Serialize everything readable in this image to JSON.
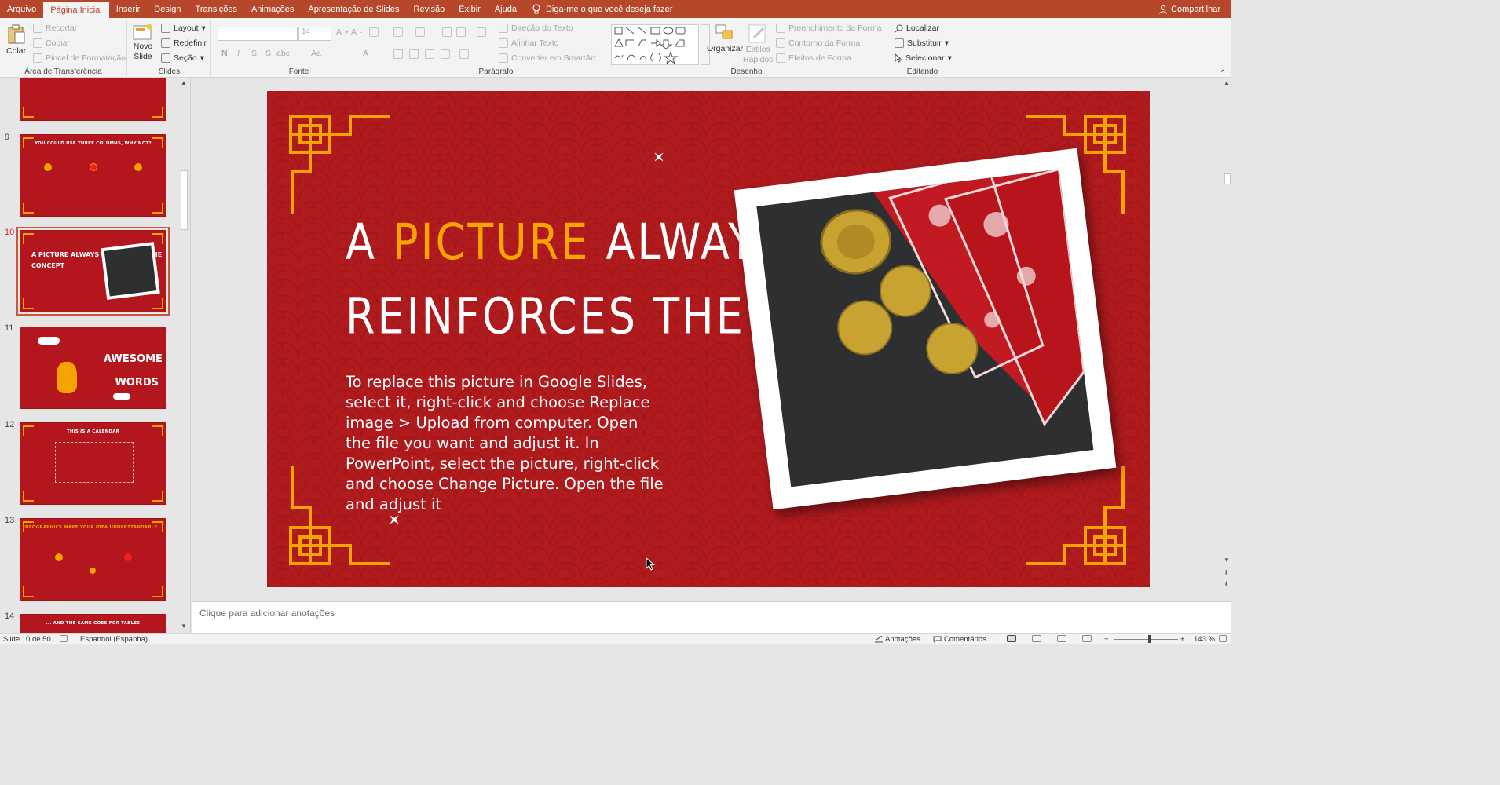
{
  "tabs": [
    "Arquivo",
    "Página Inicial",
    "Inserir",
    "Design",
    "Transições",
    "Animações",
    "Apresentação de Slides",
    "Revisão",
    "Exibir",
    "Ajuda"
  ],
  "active_tab": "Página Inicial",
  "tell_me": "Diga-me o que você deseja fazer",
  "share": "Compartilhar",
  "ribbon": {
    "clipboard": {
      "paste": "Colar",
      "cut": "Recortar",
      "copy": "Copiar",
      "format_painter": "Pincel de Formatação",
      "label": "Área de Transferência"
    },
    "slides": {
      "new_slide_1": "Novo",
      "new_slide_2": "Slide",
      "layout": "Layout",
      "reset": "Redefinir",
      "section": "Seção",
      "label": "Slides"
    },
    "font": {
      "size": "14",
      "label": "Fonte",
      "bold": "N",
      "italic": "I",
      "underline": "S",
      "shadow": "S",
      "strike": "abc",
      "case": "Aa",
      "color": "A"
    },
    "paragraph": {
      "text_direction": "Direção do Texto",
      "align_text": "Alinhar Texto",
      "smartart": "Converter em SmartArt",
      "label": "Parágrafo"
    },
    "drawing": {
      "arrange": "Organizar",
      "quick_styles_1": "Estilos",
      "quick_styles_2": "Rápidos",
      "shape_fill": "Preenchimento da Forma",
      "shape_outline": "Contorno da Forma",
      "shape_effects": "Efeitos de Forma",
      "label": "Desenho"
    },
    "editing": {
      "find": "Localizar",
      "replace": "Substituir",
      "select": "Selecionar",
      "label": "Editando"
    }
  },
  "thumbnails": [
    {
      "num": "",
      "title": ""
    },
    {
      "num": "9",
      "title": "YOU COULD USE THREE COLUMNS, WHY NOT?"
    },
    {
      "num": "10",
      "title": "A PICTURE ALWAYS REINFORCES THE CONCEPT"
    },
    {
      "num": "11",
      "title": "AWESOME WORDS"
    },
    {
      "num": "12",
      "title": "THIS IS A CALENDAR"
    },
    {
      "num": "13",
      "title": "INFOGRAPHICS MAKE YOUR IDEA UNDERSTANDABLE..."
    },
    {
      "num": "14",
      "title": "... AND THE SAME GOES FOR TABLES"
    }
  ],
  "slide": {
    "title_part1": "A ",
    "title_highlight": "PICTURE",
    "title_part2": " ALWAYS",
    "title_line2": "REINFORCES THE CONCEPT",
    "body": "To replace this picture in Google Slides, select it, right-click and choose Replace image > Upload from computer. Open the file you want and adjust it. In PowerPoint, select the picture, right-click and choose Change Picture. Open the file and adjust it"
  },
  "notes_placeholder": "Clique para adicionar anotações",
  "status": {
    "slide_info": "Slide 10 de 50",
    "language": "Espanhol (Espanha)",
    "notes": "Anotações",
    "comments": "Comentários",
    "zoom": "143 %"
  },
  "colors": {
    "accent": "#b7472a",
    "slide_bg": "#b01b1e",
    "gold": "#f9a400"
  }
}
